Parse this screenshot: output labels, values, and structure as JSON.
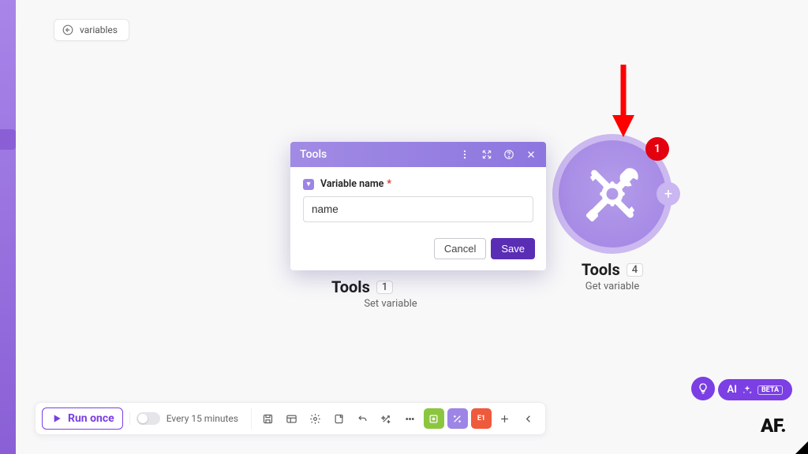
{
  "breadcrumb": {
    "label": "variables"
  },
  "nodes": {
    "left": {
      "title": "Tools",
      "count": "1",
      "subtitle": "Set variable"
    },
    "right": {
      "title": "Tools",
      "count": "4",
      "subtitle": "Get variable",
      "badge": "1"
    }
  },
  "dialog": {
    "title": "Tools",
    "field_label": "Variable name",
    "field_required": "*",
    "input_value": "name",
    "cancel": "Cancel",
    "save": "Save"
  },
  "toolbar": {
    "run": "Run once",
    "schedule": "Every 15 minutes",
    "err_badge": "E1"
  },
  "ai": {
    "label": "AI",
    "beta": "BETA"
  },
  "logo": "AF."
}
